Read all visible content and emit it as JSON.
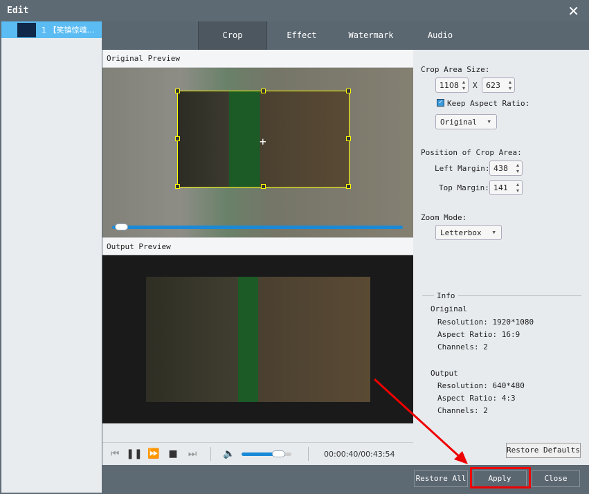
{
  "window": {
    "title": "Edit"
  },
  "sidebar": {
    "items": [
      {
        "index": "1",
        "label": "【笑镇惊魂…"
      }
    ]
  },
  "tabs": [
    {
      "label": "Crop",
      "active": true
    },
    {
      "label": "Effect"
    },
    {
      "label": "Watermark"
    },
    {
      "label": "Audio"
    }
  ],
  "preview": {
    "original_label": "Original Preview",
    "output_label": "Output Preview"
  },
  "player": {
    "time": "00:00:40/00:43:54",
    "progress_percent": 2,
    "volume_percent": 75
  },
  "crop": {
    "size_label": "Crop Area Size:",
    "width": "1108",
    "x_label": "X",
    "height": "623",
    "keep_aspect_label": "Keep Aspect Ratio:",
    "keep_aspect_checked": true,
    "aspect_value": "Original",
    "position_label": "Position of Crop Area:",
    "left_margin_label": "Left Margin:",
    "left_margin": "438",
    "top_margin_label": "Top Margin:",
    "top_margin": "141",
    "zoom_mode_label": "Zoom Mode:",
    "zoom_mode": "Letterbox"
  },
  "info": {
    "title": "Info",
    "original": {
      "title": "Original",
      "resolution": "Resolution: 1920*1080",
      "aspect": "Aspect Ratio: 16:9",
      "channels": "Channels: 2"
    },
    "output": {
      "title": "Output",
      "resolution": "Resolution: 640*480",
      "aspect": "Aspect Ratio: 4:3",
      "channels": "Channels: 2"
    }
  },
  "buttons": {
    "restore_defaults": "Restore Defaults",
    "restore_all": "Restore All",
    "apply": "Apply",
    "close": "Close"
  },
  "colors": {
    "accent": "#1a8ad8",
    "highlight": "#e00000",
    "crop_frame": "#ffff00"
  }
}
